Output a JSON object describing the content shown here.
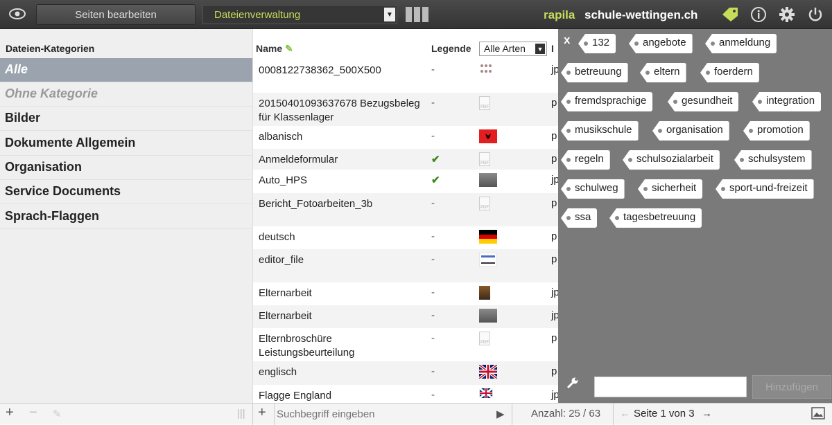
{
  "topbar": {
    "edit_pages": "Seiten bearbeiten",
    "module_select": "Dateienverwaltung",
    "brand": "rapila",
    "site": "schule-wettingen.ch"
  },
  "sidebar": {
    "heading": "Dateien-Kategorien",
    "items": [
      {
        "label": "Alle",
        "state": "active"
      },
      {
        "label": "Ohne Kategorie",
        "state": "muted"
      },
      {
        "label": "Bilder",
        "state": ""
      },
      {
        "label": "Dokumente Allgemein",
        "state": ""
      },
      {
        "label": "Organisation",
        "state": ""
      },
      {
        "label": "Service Documents",
        "state": ""
      },
      {
        "label": "Sprach-Flaggen",
        "state": ""
      }
    ]
  },
  "table": {
    "col_name": "Name",
    "col_legend": "Legende",
    "filter_value": "Alle Arten",
    "col_type": "I",
    "rows": [
      {
        "name": "0008122738362_500X500",
        "legend": "-",
        "thumb": "photo-icon",
        "type": "jp"
      },
      {
        "name": "20150401093637678 Bezugsbeleg für Klassenlager",
        "legend": "-",
        "thumb": "pdf-icon",
        "type": "p"
      },
      {
        "name": "albanisch",
        "legend": "-",
        "thumb": "flag-albania-icon",
        "type": "p"
      },
      {
        "name": "Anmeldeformular",
        "legend": "✔",
        "thumb": "pdf-icon",
        "type": "p"
      },
      {
        "name": "Auto_HPS",
        "legend": "✔",
        "thumb": "photo-icon",
        "type": "jp"
      },
      {
        "name": "Bericht_Fotoarbeiten_3b",
        "legend": "-",
        "thumb": "pdf-icon",
        "type": "p"
      },
      {
        "name": "deutsch",
        "legend": "-",
        "thumb": "flag-germany-icon",
        "type": "p"
      },
      {
        "name": "editor_file",
        "legend": "-",
        "thumb": "image-icon",
        "type": "p"
      },
      {
        "name": "Elternarbeit",
        "legend": "-",
        "thumb": "photo-icon",
        "type": "jp"
      },
      {
        "name": "Elternarbeit",
        "legend": "-",
        "thumb": "photo-icon",
        "type": "jp"
      },
      {
        "name": "Elternbroschüre Leistungsbeurteilung",
        "legend": "-",
        "thumb": "pdf-icon",
        "type": "p"
      },
      {
        "name": "englisch",
        "legend": "-",
        "thumb": "flag-uk-icon",
        "type": "p"
      },
      {
        "name": "Flagge England",
        "legend": "-",
        "thumb": "flag-uk-icon",
        "type": "jp"
      }
    ]
  },
  "tags": {
    "close": "x",
    "items": [
      "132",
      "angebote",
      "anmeldung",
      "betreuung",
      "eltern",
      "foerdern",
      "fremdsprachige",
      "gesundheit",
      "integration",
      "musikschule",
      "organisation",
      "promotion",
      "regeln",
      "schulsozialarbeit",
      "schulsystem",
      "schulweg",
      "sicherheit",
      "sport-und-freizeit",
      "ssa",
      "tagesbetreuung"
    ],
    "input_value": "",
    "add_label": "Hinzufügen"
  },
  "bottombar": {
    "search_placeholder": "Suchbegriff eingeben",
    "count": "Anzahl: 25 / 63",
    "page": "Seite 1 von 3"
  },
  "colors": {
    "accent": "#c8dc5a",
    "active_item": "#9aa3ae",
    "tag_panel": "#7a7a7a",
    "topbar": "#3a3a3a"
  }
}
